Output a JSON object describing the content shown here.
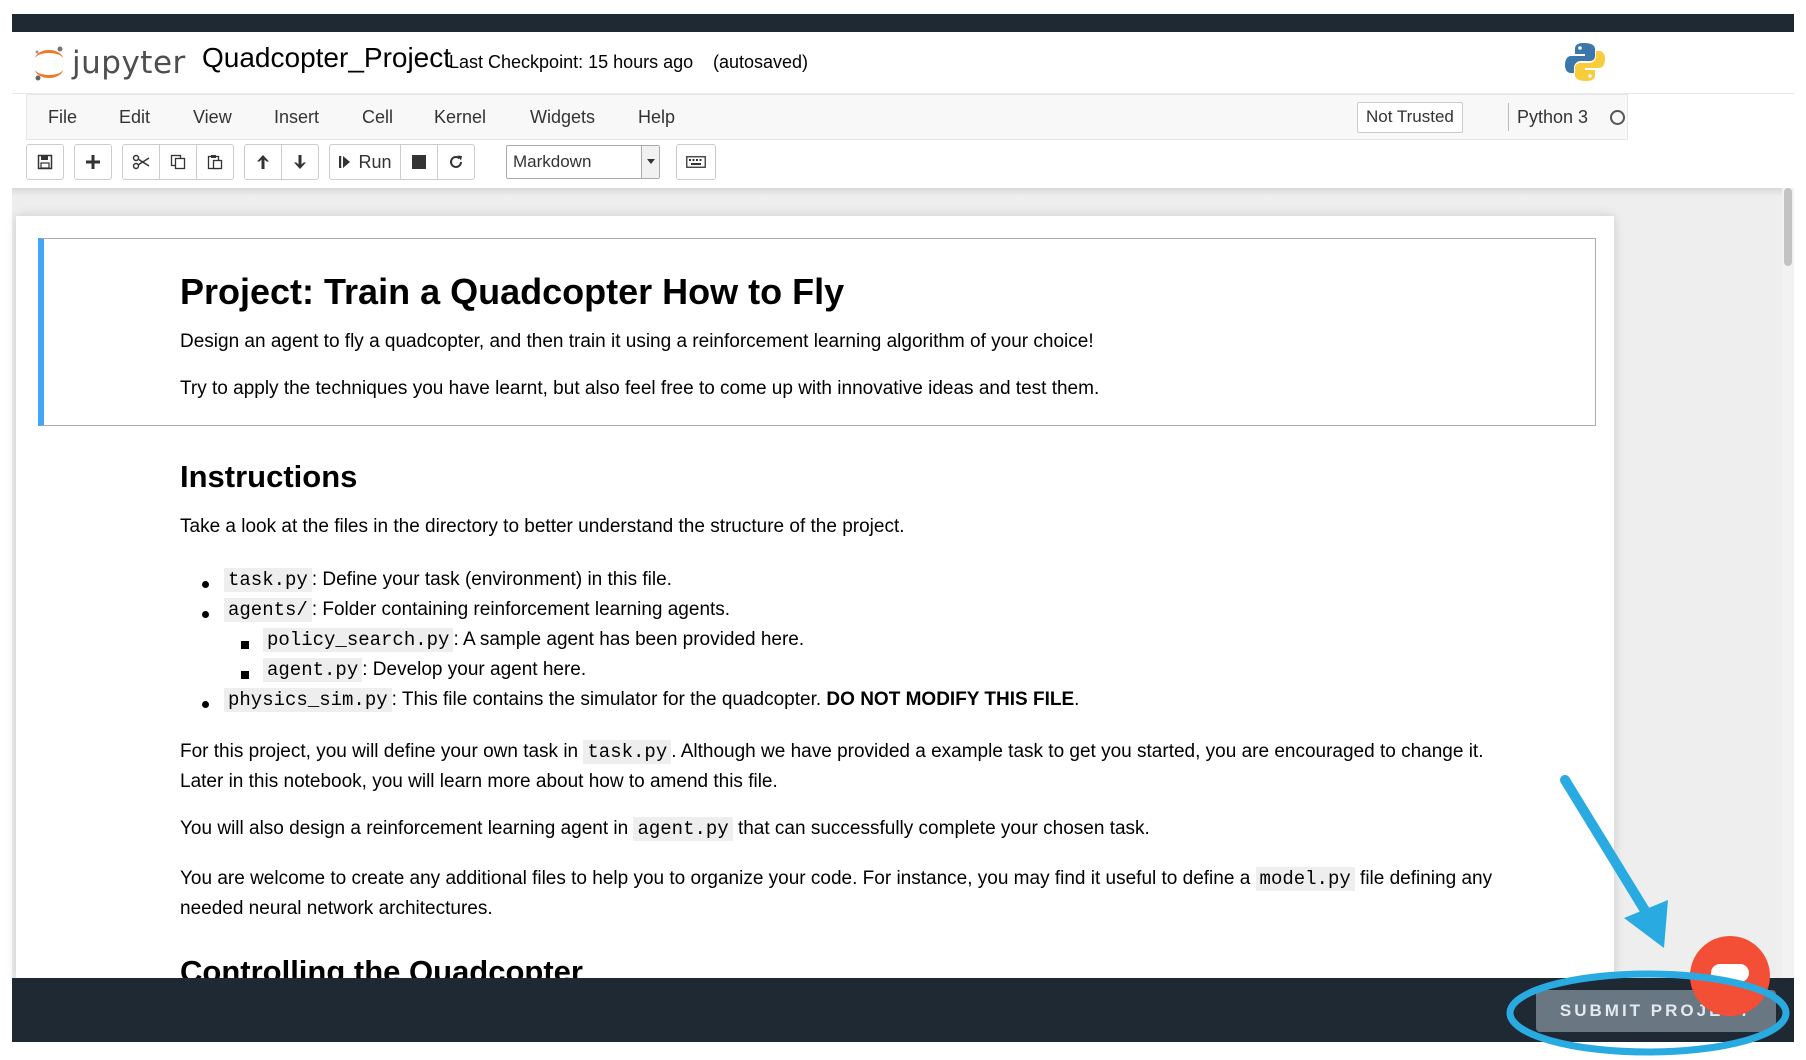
{
  "header": {
    "logo_text": "jupyter",
    "notebook_name": "Quadcopter_Project",
    "checkpoint": "Last Checkpoint: 15 hours ago",
    "autosave": "(autosaved)"
  },
  "menubar": {
    "items": [
      "File",
      "Edit",
      "View",
      "Insert",
      "Cell",
      "Kernel",
      "Widgets",
      "Help"
    ],
    "trusted": "Not Trusted",
    "kernel": "Python 3"
  },
  "toolbar": {
    "run_label": "Run",
    "cell_type": "Markdown"
  },
  "cell1": {
    "title": "Project: Train a Quadcopter How to Fly",
    "p1": "Design an agent to fly a quadcopter, and then train it using a reinforcement learning algorithm of your choice!",
    "p2": "Try to apply the techniques you have learnt, but also feel free to come up with innovative ideas and test them."
  },
  "instructions": {
    "heading": "Instructions",
    "intro": "Take a look at the files in the directory to better understand the structure of the project.",
    "task_code": "task.py",
    "task_desc": ": Define your task (environment) in this file.",
    "agents_code": "agents/",
    "agents_desc": ": Folder containing reinforcement learning agents.",
    "policy_code": "policy_search.py",
    "policy_desc": ": A sample agent has been provided here.",
    "agent_code": "agent.py",
    "agent_desc": ": Develop your agent here.",
    "physics_code": "physics_sim.py",
    "physics_desc": ": This file contains the simulator for the quadcopter. ",
    "physics_warning": "DO NOT MODIFY THIS FILE",
    "physics_end": ".",
    "para1_a": "For this project, you will define your own task in ",
    "para1_code": "task.py",
    "para1_b": ". Although we have provided a example task to get you started, you are encouraged to change it.",
    "para1_line2": "Later in this notebook, you will learn more about how to amend this file.",
    "para2_a": "You will also design a reinforcement learning agent in ",
    "para2_code": "agent.py",
    "para2_b": " that can successfully complete your chosen task.",
    "para3_a": "You are welcome to create any additional files to help you to organize your code. For instance, you may find it useful to define a ",
    "para3_code": "model.py",
    "para3_b": " file defining any",
    "para3_line2": "needed neural network architectures."
  },
  "next_heading": "Controlling the Quadcopter",
  "footer": {
    "submit_label": "SUBMIT PROJECT"
  },
  "colors": {
    "selected_cell_border": "#42a5f5",
    "bottom_bar": "#1f2933",
    "submit_button": "#687782",
    "chat_button": "#f24f36",
    "annotation": "#29abe2"
  }
}
